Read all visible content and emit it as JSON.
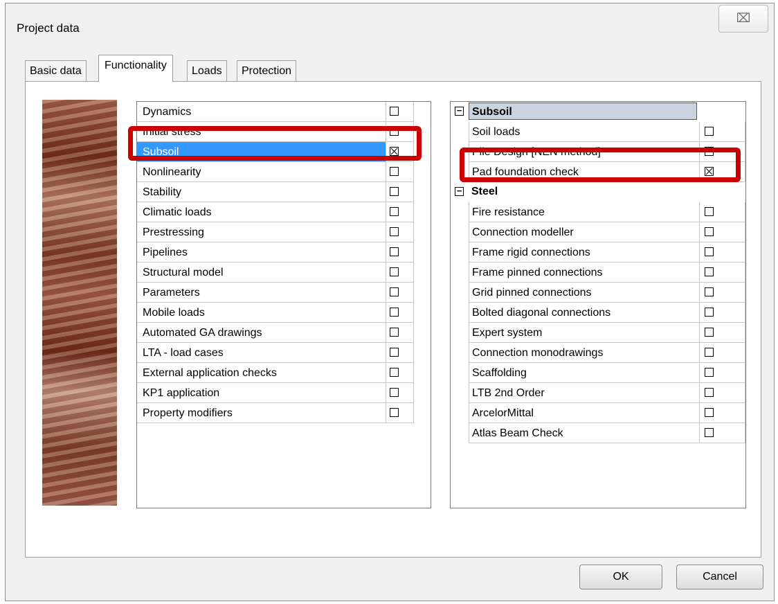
{
  "window": {
    "title": "Project data",
    "close_glyph": "⌧"
  },
  "tabs": [
    {
      "label": "Basic data",
      "active": false
    },
    {
      "label": "Functionality",
      "active": true
    },
    {
      "label": "Loads",
      "active": false
    },
    {
      "label": "Protection",
      "active": false
    }
  ],
  "functionality_list": [
    {
      "label": "Dynamics",
      "checked": false
    },
    {
      "label": "Initial stress",
      "checked": false
    },
    {
      "label": "Subsoil",
      "checked": true,
      "selected": true
    },
    {
      "label": "Nonlinearity",
      "checked": false
    },
    {
      "label": "Stability",
      "checked": false
    },
    {
      "label": "Climatic loads",
      "checked": false
    },
    {
      "label": "Prestressing",
      "checked": false
    },
    {
      "label": "Pipelines",
      "checked": false
    },
    {
      "label": "Structural model",
      "checked": false
    },
    {
      "label": "Parameters",
      "checked": false
    },
    {
      "label": "Mobile loads",
      "checked": false
    },
    {
      "label": "Automated GA drawings",
      "checked": false
    },
    {
      "label": "LTA - load cases",
      "checked": false
    },
    {
      "label": "External application checks",
      "checked": false
    },
    {
      "label": "KP1 application",
      "checked": false
    },
    {
      "label": "Property modifiers",
      "checked": false
    }
  ],
  "subsoil_group": {
    "title": "Subsoil",
    "expander": "⊟",
    "items": [
      {
        "label": "Soil loads",
        "checked": false
      },
      {
        "label": "Pile Design [NEN method]",
        "checked": false
      },
      {
        "label": "Pad foundation check",
        "checked": true
      }
    ]
  },
  "steel_group": {
    "title": "Steel",
    "expander": "⊟",
    "items": [
      {
        "label": "Fire resistance",
        "checked": false
      },
      {
        "label": "Connection modeller",
        "checked": false
      },
      {
        "label": "Frame rigid connections",
        "checked": false
      },
      {
        "label": "Frame pinned connections",
        "checked": false
      },
      {
        "label": "Grid pinned connections",
        "checked": false
      },
      {
        "label": "Bolted diagonal connections",
        "checked": false
      },
      {
        "label": "Expert system",
        "checked": false
      },
      {
        "label": "Connection monodrawings",
        "checked": false
      },
      {
        "label": "Scaffolding",
        "checked": false
      },
      {
        "label": "LTB 2nd Order",
        "checked": false
      },
      {
        "label": "ArcelorMittal",
        "checked": false
      },
      {
        "label": "Atlas Beam Check",
        "checked": false
      }
    ]
  },
  "buttons": {
    "ok": "OK",
    "cancel": "Cancel"
  },
  "colors": {
    "selection": "#3399ff",
    "highlight": "#cc0000",
    "group_header": "#c9d4e0"
  }
}
